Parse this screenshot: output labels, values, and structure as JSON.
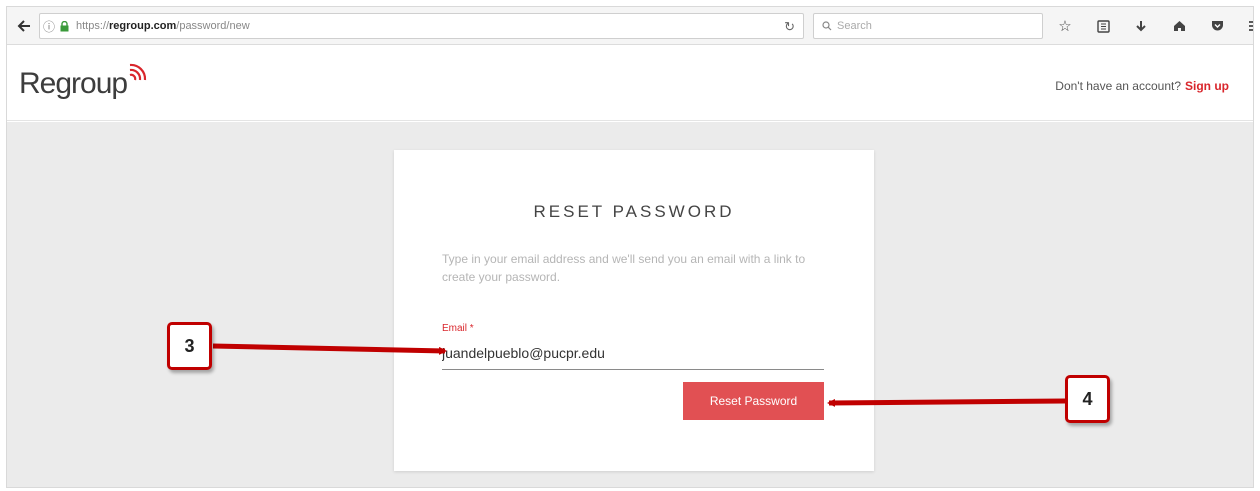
{
  "browser": {
    "url_prefix": "https://",
    "url_domain": "regroup.com",
    "url_path": "/password/new",
    "search_placeholder": "Search"
  },
  "header": {
    "logo_text": "Regroup",
    "account_prompt": "Don't have an account?",
    "signup_label": "Sign up"
  },
  "form": {
    "title": "RESET PASSWORD",
    "description": "Type in your email address and we'll send you an email with a link to create your password.",
    "email_label": "Email *",
    "email_value": "juandelpueblo@pucpr.edu",
    "submit_label": "Reset Password"
  },
  "callouts": {
    "email_step": "3",
    "submit_step": "4"
  },
  "colors": {
    "accent_red": "#d9262c",
    "button_red": "#e15053",
    "callout_red": "#c00000"
  }
}
